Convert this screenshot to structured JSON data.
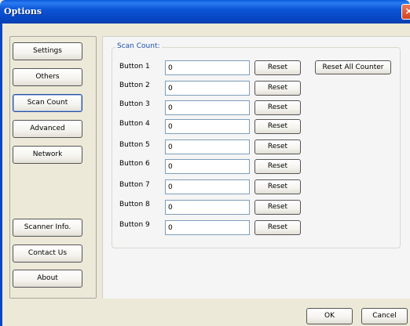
{
  "window": {
    "title": "Options",
    "close_label": "×"
  },
  "nav": {
    "items": [
      {
        "label": "Settings"
      },
      {
        "label": "Others"
      },
      {
        "label": "Scan Count"
      },
      {
        "label": "Advanced"
      },
      {
        "label": "Network"
      }
    ],
    "bottom_items": [
      {
        "label": "Scanner Info."
      },
      {
        "label": "Contact Us"
      },
      {
        "label": "About"
      }
    ],
    "active": "Scan Count"
  },
  "scan_count": {
    "group_title": "Scan Count:",
    "reset_all_label": "Reset All Counter",
    "rows": [
      {
        "label": "Button 1",
        "value": "0",
        "reset_label": "Reset"
      },
      {
        "label": "Button 2",
        "value": "0",
        "reset_label": "Reset"
      },
      {
        "label": "Button 3",
        "value": "0",
        "reset_label": "Reset"
      },
      {
        "label": "Button 4",
        "value": "0",
        "reset_label": "Reset"
      },
      {
        "label": "Button 5",
        "value": "0",
        "reset_label": "Reset"
      },
      {
        "label": "Button 6",
        "value": "0",
        "reset_label": "Reset"
      },
      {
        "label": "Button 7",
        "value": "0",
        "reset_label": "Reset"
      },
      {
        "label": "Button 8",
        "value": "0",
        "reset_label": "Reset"
      },
      {
        "label": "Button 9",
        "value": "0",
        "reset_label": "Reset"
      }
    ]
  },
  "footer": {
    "ok_label": "OK",
    "cancel_label": "Cancel"
  }
}
